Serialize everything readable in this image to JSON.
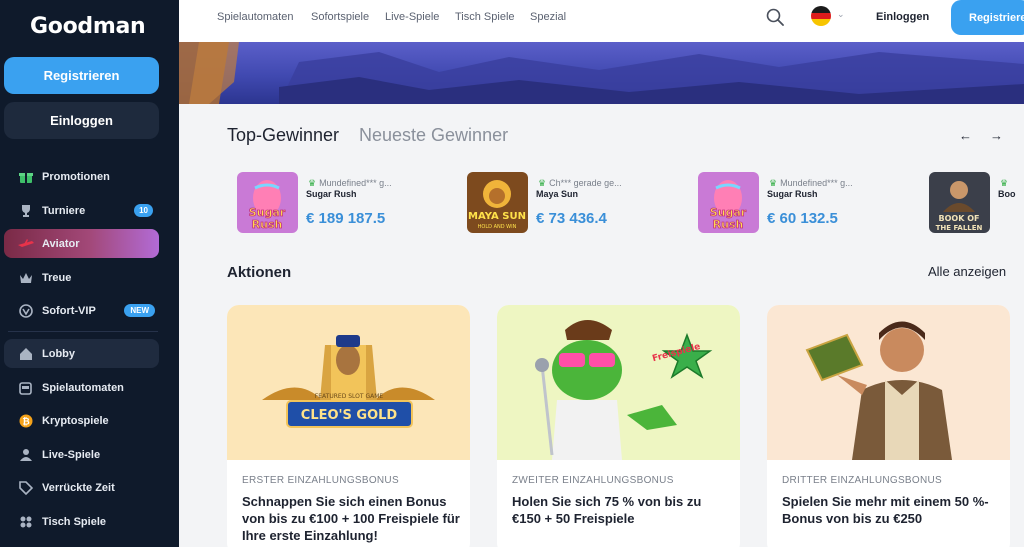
{
  "sidebar": {
    "logo": "Goodman",
    "register_label": "Registrieren",
    "login_label": "Einloggen",
    "items": [
      {
        "label": "Promotionen",
        "icon": "gift-icon"
      },
      {
        "label": "Turniere",
        "icon": "trophy-icon",
        "badge": "10"
      },
      {
        "label": "Aviator",
        "icon": "plane-icon"
      },
      {
        "label": "Treue",
        "icon": "crown-icon"
      },
      {
        "label": "Sofort-VIP",
        "icon": "vip-icon",
        "badge": "NEW"
      },
      {
        "label": "Lobby",
        "icon": "home-icon"
      },
      {
        "label": "Spielautomaten",
        "icon": "slot-machine-icon"
      },
      {
        "label": "Kryptospiele",
        "icon": "bitcoin-icon"
      },
      {
        "label": "Live-Spiele",
        "icon": "dealer-icon"
      },
      {
        "label": "Verrückte Zeit",
        "icon": "tag-icon"
      },
      {
        "label": "Tisch Spiele",
        "icon": "table-games-icon"
      }
    ]
  },
  "header": {
    "nav": [
      "Spielautomaten",
      "Sofortspiele",
      "Live-Spiele",
      "Tisch Spiele",
      "Spezial"
    ],
    "login_label": "Einloggen",
    "register_label": "Registrieren"
  },
  "winners": {
    "title": "Top-Gewinner",
    "subtitle": "Neueste Gewinner",
    "items": [
      {
        "user": "Mundefined*** g...",
        "game": "Sugar Rush",
        "amount": "€ 189 187.5"
      },
      {
        "user": "Ch*** gerade ge...",
        "game": "Maya Sun",
        "amount": "€ 73 436.4"
      },
      {
        "user": "Mundefined*** g...",
        "game": "Sugar Rush",
        "amount": "€ 60 132.5"
      },
      {
        "user": "",
        "game": "Boo",
        "amount": ""
      }
    ]
  },
  "promos": {
    "title": "Aktionen",
    "see_all": "Alle anzeigen",
    "cards": [
      {
        "tag": "ERSTER EINZAHLUNGSBONUS",
        "text": "Schnappen Sie sich einen Bonus von bis zu €100 + 100 Freispiele für Ihre erste Einzahlung!",
        "image_label_top": "FEATURED SLOT GAME",
        "image_label": "CLEO'S GOLD"
      },
      {
        "tag": "ZWEITER EINZAHLUNGSBONUS",
        "text": "Holen Sie sich 75 % von bis zu €150 + 50 Freispiele",
        "image_label": "Freispiele"
      },
      {
        "tag": "DRITTER EINZAHLUNGSBONUS",
        "text": "Spielen Sie mehr mit einem 50 %-Bonus von bis zu €250"
      }
    ]
  },
  "thumb_labels": {
    "sugar": [
      "Sugar",
      "Rush"
    ],
    "maya": [
      "MAYA SUN",
      "HOLD AND WIN"
    ],
    "book": [
      "BOOK OF",
      "THE FALLEN"
    ]
  },
  "colors": {
    "accent": "#3aa1f0",
    "sidebar_bg": "#0f1a2b",
    "amount": "#3a8fd8"
  }
}
